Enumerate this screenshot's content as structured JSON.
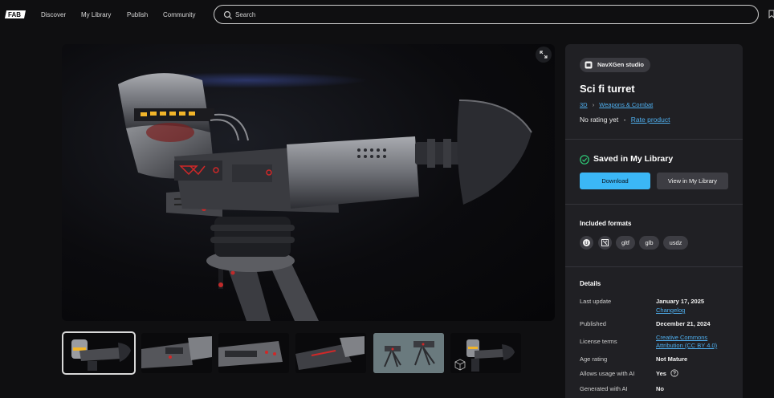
{
  "nav": {
    "logo_text": "FAB",
    "links": [
      "Discover",
      "My Library",
      "Publish",
      "Community"
    ]
  },
  "search": {
    "placeholder": "Search"
  },
  "gallery": {
    "thumbnail_count": 6,
    "selected_index": 0
  },
  "product": {
    "studio": "NavXGen studio",
    "title": "Sci fi turret",
    "breadcrumb": [
      "3D",
      "Weapons & Combat"
    ],
    "rating_text": "No rating yet",
    "rating_sep": "-",
    "rate_link": "Rate product"
  },
  "library": {
    "status": "Saved in My Library",
    "download_label": "Download",
    "view_label": "View in My Library"
  },
  "formats": {
    "heading": "Included formats",
    "items": [
      "gltf",
      "glb",
      "usdz"
    ]
  },
  "details": {
    "heading": "Details",
    "last_update_label": "Last update",
    "last_update_value": "January 17, 2025",
    "changelog_link": "Changelog",
    "published_label": "Published",
    "published_value": "December 21, 2024",
    "license_label": "License terms",
    "license_link_1": "Creative Commons",
    "license_link_2": "Attribution (CC BY 4.0)",
    "age_label": "Age rating",
    "age_value": "Not Mature",
    "ai_usage_label": "Allows usage with AI",
    "ai_usage_value": "Yes",
    "generated_label": "Generated with AI",
    "generated_value": "No"
  },
  "colors": {
    "accent": "#3bb7f6",
    "link": "#4fb0f0",
    "success": "#2fd07a",
    "panel": "#202024",
    "background": "#0f0f11"
  }
}
